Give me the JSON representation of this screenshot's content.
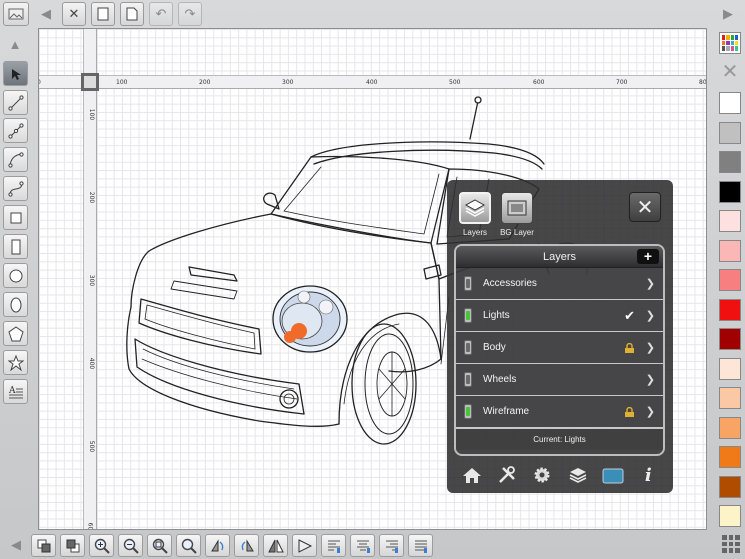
{
  "top_toolbar": {
    "icons": [
      "image-icon",
      "back-arrow-icon",
      "close-document-icon",
      "copy-icon",
      "page-icon",
      "undo-icon",
      "redo-icon",
      "forward-arrow-icon"
    ]
  },
  "rulers": {
    "horizontal": [
      "100",
      "200",
      "300",
      "400",
      "500",
      "600",
      "700",
      "80"
    ],
    "vertical": [
      "100",
      "200",
      "300",
      "400",
      "500",
      "60"
    ]
  },
  "layers_panel": {
    "tabs": [
      {
        "label": "Layers",
        "icon": "layers-icon",
        "active": true
      },
      {
        "label": "BG Layer",
        "icon": "bg-layer-icon",
        "active": false
      }
    ],
    "close_label": "✕",
    "header": "Layers",
    "add_label": "+",
    "layers": [
      {
        "name": "Accessories",
        "visible": false,
        "current": false,
        "locked": false
      },
      {
        "name": "Lights",
        "visible": true,
        "current": true,
        "locked": false
      },
      {
        "name": "Body",
        "visible": false,
        "current": false,
        "locked": true
      },
      {
        "name": "Wheels",
        "visible": false,
        "current": false,
        "locked": false
      },
      {
        "name": "Wireframe",
        "visible": true,
        "current": false,
        "locked": true
      }
    ],
    "current_text": "Current: Lights",
    "bottom_icons": [
      "home-icon",
      "tools-icon",
      "gear-icon",
      "layers-stack-icon",
      "folder-icon",
      "info-icon"
    ]
  },
  "palette": {
    "swatches": [
      "#ffffff",
      "#c0c0c0",
      "#808080",
      "#000000",
      "#fde0e0",
      "#fbb6b6",
      "#f77f7f",
      "#f01010",
      "#a00000",
      "#fde6d8",
      "#fbc8a6",
      "#f8a464",
      "#f07a18",
      "#b04c00",
      "#fdf3c8"
    ]
  },
  "colors": {
    "panel_bg": "#2d2d2f",
    "toggle_on": "#46c43a",
    "headlight": "#f06a2a"
  }
}
